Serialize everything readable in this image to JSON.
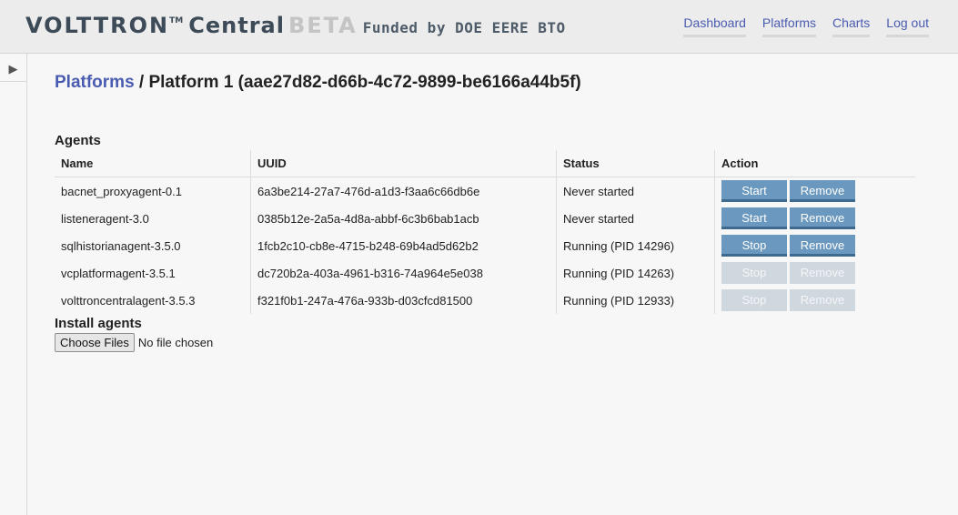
{
  "header": {
    "brand": "VOLTTRON",
    "tm": "TM",
    "central": "Central",
    "beta": "BETA",
    "funded": "Funded by DOE EERE BTO",
    "nav": [
      "Dashboard",
      "Platforms",
      "Charts",
      "Log out"
    ]
  },
  "sidebar": {
    "toggle_icon": "play-triangle-icon",
    "toggle_glyph": "▶"
  },
  "breadcrumb": {
    "link": "Platforms",
    "separator": " / ",
    "current": "Platform 1 (aae27d82-d66b-4c72-9899-be6166a44b5f)"
  },
  "agents": {
    "title": "Agents",
    "columns": [
      "Name",
      "UUID",
      "Status",
      "Action"
    ],
    "rows": [
      {
        "name": "bacnet_proxyagent-0.1",
        "uuid": "6a3be214-27a7-476d-a1d3-f3aa6c66db6e",
        "status": "Never started",
        "primary": "Start",
        "primary_enabled": true,
        "remove": "Remove",
        "remove_enabled": true
      },
      {
        "name": "listeneragent-3.0",
        "uuid": "0385b12e-2a5a-4d8a-abbf-6c3b6bab1acb",
        "status": "Never started",
        "primary": "Start",
        "primary_enabled": true,
        "remove": "Remove",
        "remove_enabled": true
      },
      {
        "name": "sqlhistorianagent-3.5.0",
        "uuid": "1fcb2c10-cb8e-4715-b248-69b4ad5d62b2",
        "status": "Running (PID 14296)",
        "primary": "Stop",
        "primary_enabled": true,
        "remove": "Remove",
        "remove_enabled": true
      },
      {
        "name": "vcplatformagent-3.5.1",
        "uuid": "dc720b2a-403a-4961-b316-74a964e5e038",
        "status": "Running (PID 14263)",
        "primary": "Stop",
        "primary_enabled": false,
        "remove": "Remove",
        "remove_enabled": false
      },
      {
        "name": "volttroncentralagent-3.5.3",
        "uuid": "f321f0b1-247a-476a-933b-d03cfcd81500",
        "status": "Running (PID 12933)",
        "primary": "Stop",
        "primary_enabled": false,
        "remove": "Remove",
        "remove_enabled": false
      }
    ]
  },
  "install": {
    "title": "Install agents",
    "button": "Choose Files",
    "no_file": "No file chosen"
  },
  "colors": {
    "accent": "#4a5cb0",
    "button": "#6b98be",
    "button_disabled": "#cfd7df"
  }
}
